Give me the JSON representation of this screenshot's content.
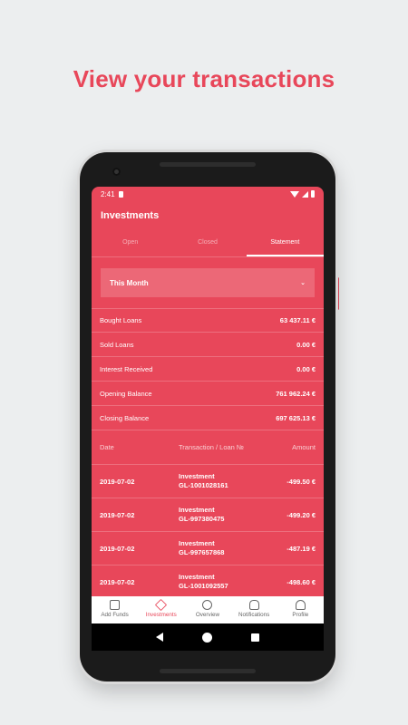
{
  "headline": "View your transactions",
  "status": {
    "time": "2:41"
  },
  "app": {
    "title": "Investments"
  },
  "tabs": [
    {
      "label": "Open",
      "active": false
    },
    {
      "label": "Closed",
      "active": false
    },
    {
      "label": "Statement",
      "active": true
    }
  ],
  "period": {
    "selected": "This Month"
  },
  "summary": [
    {
      "label": "Bought Loans",
      "value": "63 437.11 €"
    },
    {
      "label": "Sold Loans",
      "value": "0.00 €"
    },
    {
      "label": "Interest Received",
      "value": "0.00 €"
    },
    {
      "label": "Opening Balance",
      "value": "761 962.24 €"
    },
    {
      "label": "Closing Balance",
      "value": "697 625.13 €"
    }
  ],
  "table": {
    "headers": {
      "date": "Date",
      "transaction": "Transaction / Loan №",
      "amount": "Amount"
    },
    "rows": [
      {
        "date": "2019-07-02",
        "type": "Investment",
        "loan": "GL-1001028161",
        "amount": "-499.50  €"
      },
      {
        "date": "2019-07-02",
        "type": "Investment",
        "loan": "GL-997380475",
        "amount": "-499.20  €"
      },
      {
        "date": "2019-07-02",
        "type": "Investment",
        "loan": "GL-997657868",
        "amount": "-487.19  €"
      },
      {
        "date": "2019-07-02",
        "type": "Investment",
        "loan": "GL-1001092557",
        "amount": "-498.60  €"
      }
    ]
  },
  "bottom_nav": [
    {
      "label": "Add Funds",
      "icon": "wallet-icon",
      "active": false
    },
    {
      "label": "Investments",
      "icon": "layers-icon",
      "active": true
    },
    {
      "label": "Overview",
      "icon": "plus-circle-icon",
      "active": false
    },
    {
      "label": "Notifications",
      "icon": "bell-icon",
      "active": false
    },
    {
      "label": "Profile",
      "icon": "user-icon",
      "active": false
    }
  ],
  "colors": {
    "accent": "#e8475a",
    "background": "#eceeef"
  }
}
